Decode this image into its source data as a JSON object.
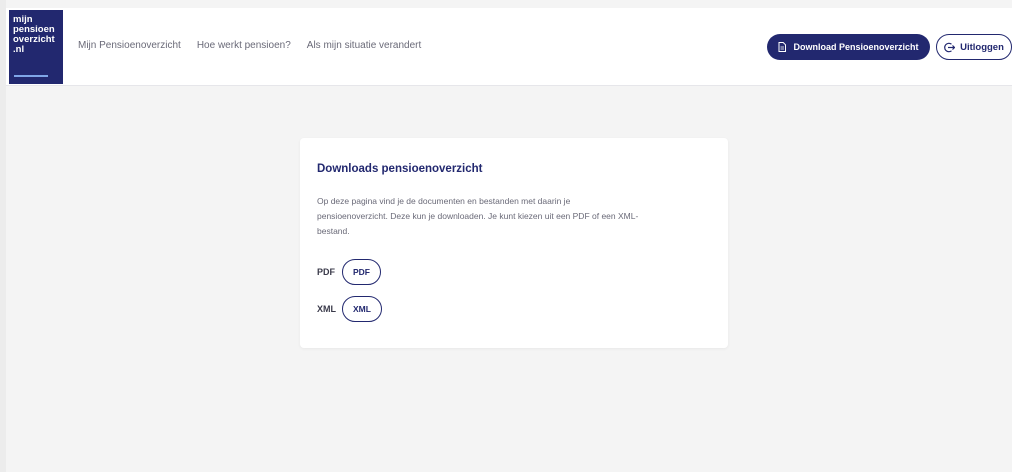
{
  "logo": {
    "lines": [
      "mijn",
      "pensioen",
      "overzicht",
      ".nl"
    ]
  },
  "nav": {
    "items": [
      "Mijn Pensioenoverzicht",
      "Hoe werkt pensioen?",
      "Als mijn situatie verandert"
    ]
  },
  "header_actions": {
    "download_label": "Download Pensioenoverzicht",
    "logout_label": "Uitloggen"
  },
  "downloads": {
    "title": "Downloads pensioenoverzicht",
    "body_lines": [
      "Op deze pagina vind je de documenten en bestanden met daarin je",
      "pensioenoverzicht. Deze kun je downloaden. Je kunt kiezen uit een PDF of een XML-",
      "bestand."
    ],
    "files": [
      {
        "label": "PDF",
        "button": "PDF"
      },
      {
        "label": "XML",
        "button": "XML"
      }
    ]
  },
  "colors": {
    "brand_navy": "#22286f",
    "background": "#f4f4f4",
    "card": "#ffffff",
    "muted_text": "#6a6a78"
  }
}
